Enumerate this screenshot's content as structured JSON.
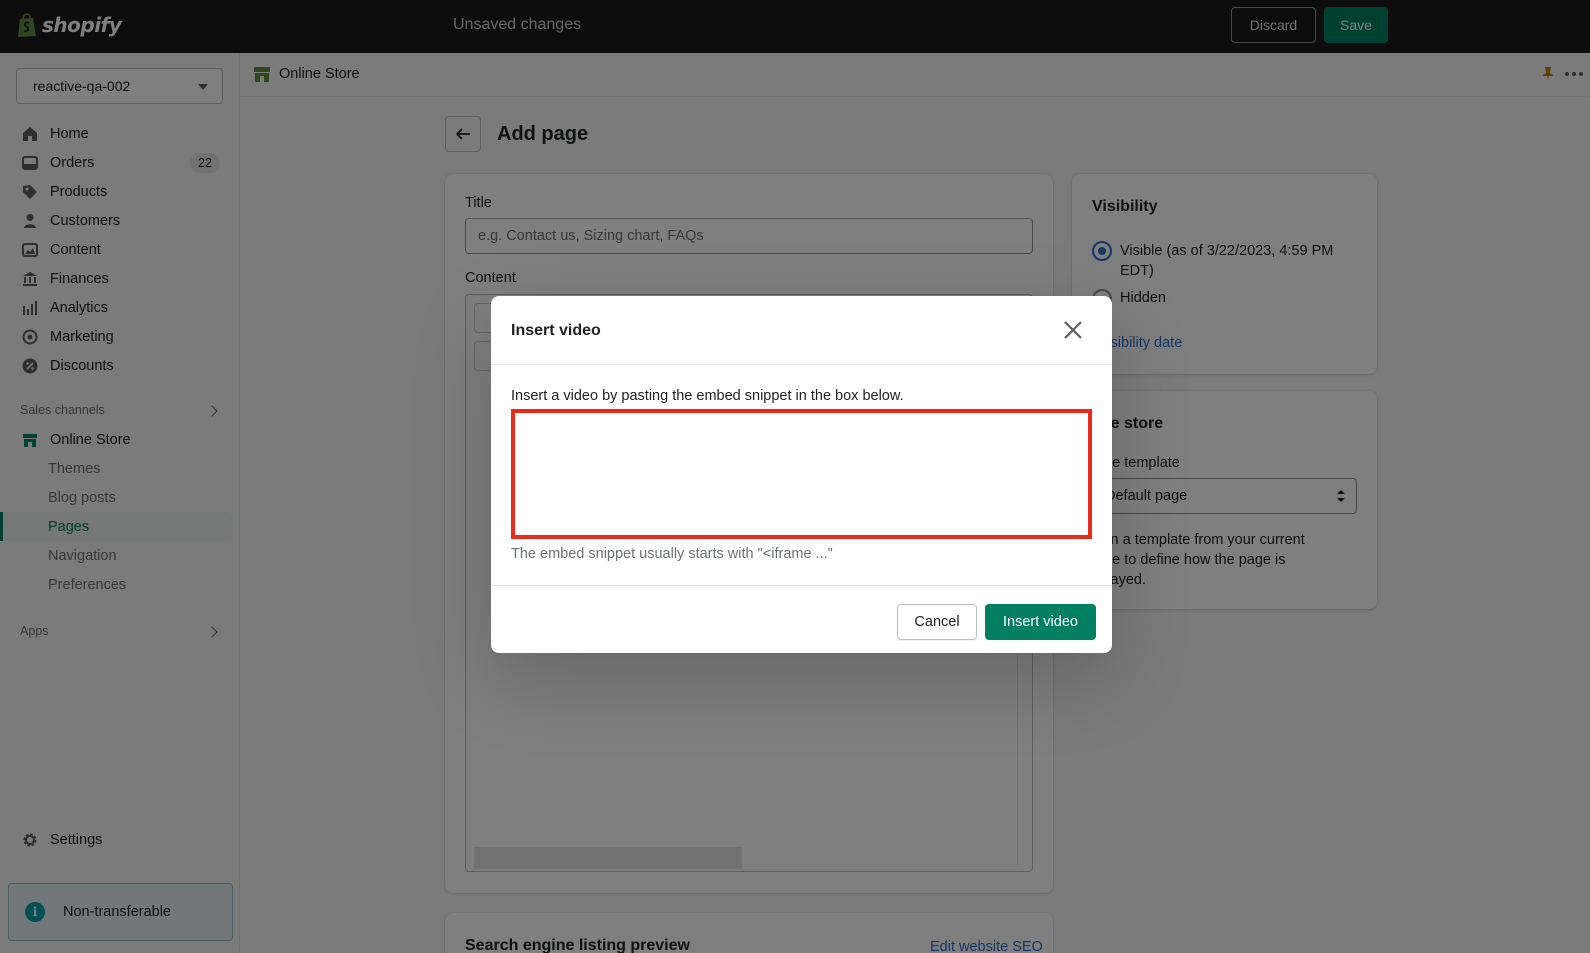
{
  "topbar": {
    "logo_text": "shopify",
    "status": "Unsaved changes",
    "discard_label": "Discard",
    "save_label": "Save"
  },
  "sidebar": {
    "store_name": "reactive-qa-002",
    "items": [
      {
        "label": "Home",
        "icon": "home-icon"
      },
      {
        "label": "Orders",
        "icon": "orders-icon",
        "badge": "22"
      },
      {
        "label": "Products",
        "icon": "tag-icon"
      },
      {
        "label": "Customers",
        "icon": "person-icon"
      },
      {
        "label": "Content",
        "icon": "content-icon"
      },
      {
        "label": "Finances",
        "icon": "bank-icon"
      },
      {
        "label": "Analytics",
        "icon": "bar-chart-icon"
      },
      {
        "label": "Marketing",
        "icon": "target-icon"
      },
      {
        "label": "Discounts",
        "icon": "discount-icon"
      }
    ],
    "sales_channels_label": "Sales channels",
    "online_store_label": "Online Store",
    "sub_items": [
      "Themes",
      "Blog posts",
      "Pages",
      "Navigation",
      "Preferences"
    ],
    "active_sub_item": "Pages",
    "apps_label": "Apps",
    "settings_label": "Settings",
    "notice_label": "Non-transferable"
  },
  "appbar": {
    "title": "Online Store"
  },
  "page": {
    "title": "Add page",
    "title_label": "Title",
    "title_placeholder": "e.g. Contact us, Sizing chart, FAQs",
    "content_label": "Content"
  },
  "visibility": {
    "heading": "Visibility",
    "visible_label_line1": "Visible (as of 3/22/2023, 4:59 PM",
    "visible_label_line2": "EDT)",
    "hidden_label": "Hidden",
    "set_date_link": "t visibility date"
  },
  "online_store_card": {
    "heading": "line store",
    "template_label": "eme template",
    "template_value": "Default page",
    "help_line1": "sign a template from your current",
    "help_line2": "eme to define how the page is",
    "help_line3": "splayed."
  },
  "seo": {
    "heading": "Search engine listing preview",
    "edit_link": "Edit website SEO"
  },
  "modal": {
    "title": "Insert video",
    "description": "Insert a video by pasting the embed snippet in the box below.",
    "embed_value": "",
    "hint": "The embed snippet usually starts with \"<iframe ...\"",
    "cancel_label": "Cancel",
    "insert_label": "Insert video"
  },
  "colors": {
    "primary": "#008060",
    "topbar": "#1a1a1a",
    "highlight": "#ea2a1a",
    "link": "#2c6ecb"
  }
}
